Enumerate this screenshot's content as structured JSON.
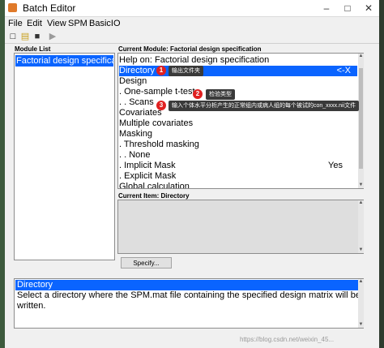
{
  "window": {
    "title": "Batch Editor"
  },
  "menu": [
    "File",
    "Edit",
    "View",
    "SPM",
    "BasicIO"
  ],
  "toolbar": {
    "icons": [
      "new-file-icon",
      "open-folder-icon",
      "save-icon",
      "run-icon"
    ],
    "glyphs": [
      "□",
      "▤",
      "■",
      "▶"
    ]
  },
  "module_list": {
    "label": "Module List",
    "items": [
      "Factorial design specification"
    ]
  },
  "current_module": {
    "label": "Current Module: Factorial design specification",
    "rows": [
      {
        "text": "Help on: Factorial design specification",
        "value": ""
      },
      {
        "text": "Directory",
        "value": "<-X"
      },
      {
        "text": "Design",
        "value": ""
      },
      {
        "text": ". One-sample t-test",
        "value": ""
      },
      {
        "text": ". . Scans",
        "value": ""
      },
      {
        "text": "Covariates",
        "value": ""
      },
      {
        "text": "Multiple covariates",
        "value": ""
      },
      {
        "text": "Masking",
        "value": ""
      },
      {
        "text": ". Threshold masking",
        "value": ""
      },
      {
        "text": ". . None",
        "value": ""
      },
      {
        "text": ". Implicit Mask",
        "value": "Yes"
      },
      {
        "text": ". Explicit Mask",
        "value": ""
      },
      {
        "text": "Global calculation",
        "value": ""
      }
    ]
  },
  "current_item": {
    "label": "Current Item: Directory",
    "button": "Specify..."
  },
  "help": {
    "title": "Directory",
    "body": "Select a directory where the SPM.mat file containing the specified design matrix will be written."
  },
  "annotations": [
    {
      "num": "1",
      "text": "输出文件夹"
    },
    {
      "num": "2",
      "text": "检验类型"
    },
    {
      "num": "3",
      "text": "输入个体水平分析产生的正常组内或病人组的每个被试的con_xxxx.nii文件"
    }
  ],
  "watermark": "https://blog.csdn.net/weixin_45..."
}
